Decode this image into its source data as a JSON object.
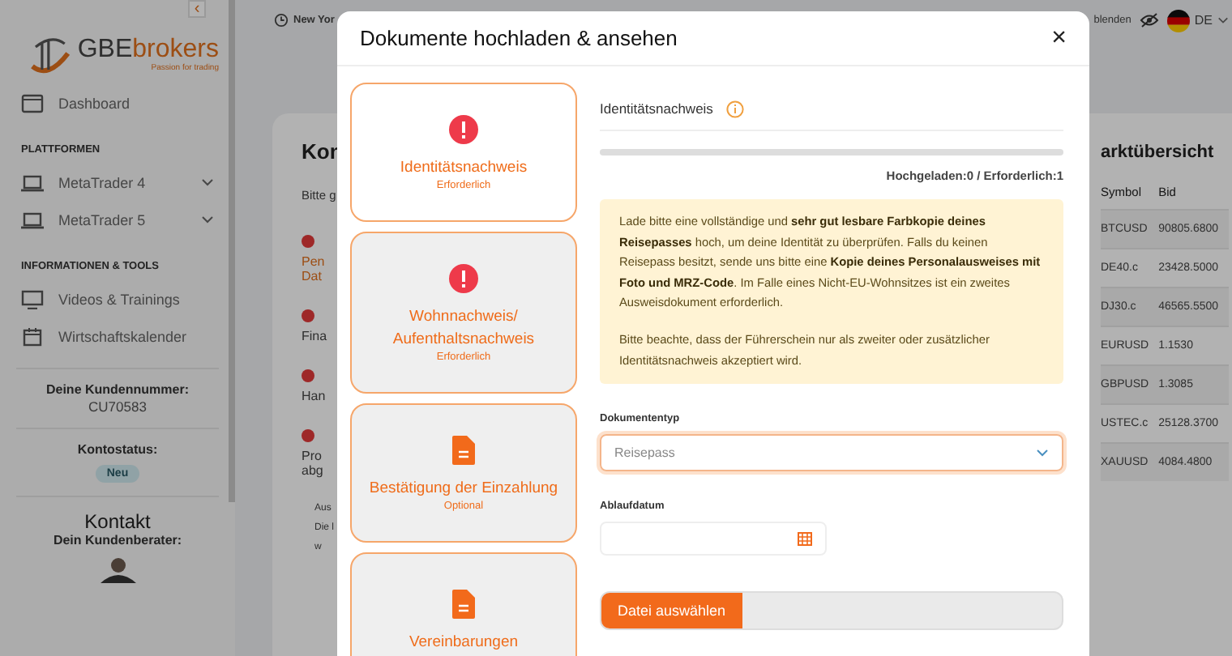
{
  "sidebar": {
    "logo": {
      "brand_a": "GBE",
      "brand_b": "brokers",
      "tagline": "Passion for trading"
    },
    "collapse_glyph": "‹",
    "items": [
      {
        "kind": "link",
        "label": "Dashboard"
      },
      {
        "kind": "section",
        "label": "PLATTFORMEN"
      },
      {
        "kind": "link",
        "label": "MetaTrader 4",
        "expandable": true
      },
      {
        "kind": "link",
        "label": "MetaTrader 5",
        "expandable": true
      },
      {
        "kind": "section",
        "label": "INFORMATIONEN & TOOLS"
      },
      {
        "kind": "link",
        "label": "Videos & Trainings"
      },
      {
        "kind": "link",
        "label": "Wirtschaftskalender"
      }
    ],
    "customer": {
      "label": "Deine Kundennummer:",
      "value": "CU70583"
    },
    "status": {
      "label": "Kontostatus:",
      "badge": "Neu"
    },
    "contact": {
      "title": "Kontakt",
      "subtitle": "Dein Kundenberater:"
    }
  },
  "topbar": {
    "clock": "New Yor",
    "toggle": "blenden",
    "language": "DE"
  },
  "account_card": {
    "title": "Kon",
    "intro": "Bitte g",
    "items": [
      {
        "lines": [
          "Pen",
          "Dat"
        ],
        "highlighted": true
      },
      {
        "lines": [
          "Fina"
        ],
        "highlighted": false
      },
      {
        "lines": [
          "Han"
        ],
        "highlighted": false
      },
      {
        "lines": [
          "Pro",
          "abg"
        ],
        "highlighted": false
      }
    ],
    "footer": [
      "Aus",
      "Die l",
      "w"
    ]
  },
  "market": {
    "title": "arktübersicht",
    "columns": [
      "Symbol",
      "Bid"
    ],
    "rows": [
      [
        "BTCUSD",
        "90805.6800"
      ],
      [
        "DE40.c",
        "23428.5000"
      ],
      [
        "DJ30.c",
        "46565.5500"
      ],
      [
        "EURUSD",
        "1.1530"
      ],
      [
        "GBPUSD",
        "1.3085"
      ],
      [
        "USTEC.c",
        "25128.3700"
      ],
      [
        "XAUUSD",
        "4084.4800"
      ]
    ]
  },
  "modal": {
    "title": "Dokumente hochladen & ansehen",
    "close": "×",
    "documents": [
      {
        "kind": "error",
        "title": "Identitätsnachweis",
        "status": "Erforderlich",
        "selected": true
      },
      {
        "kind": "error",
        "title": "Wohnnachweis/ Aufenthaltsnachweis",
        "status": "Erforderlich",
        "selected": false
      },
      {
        "kind": "document",
        "title": "Bestätigung der Einzahlung",
        "status": "Optional",
        "selected": false
      },
      {
        "kind": "document",
        "title": "Vereinbarungen",
        "selected": false
      }
    ],
    "section_title": "Identitätsnachweis",
    "progress": {
      "level": 0,
      "caption": "Hochgeladen:0 / Erforderlich:1"
    },
    "notice": [
      "Lade bitte eine vollständige und **sehr gut lesbare Farbkopie deines Reisepasses** hoch, um deine Identität zu überprüfen. Falls du keinen Reisepass besitzt, sende uns bitte eine **Kopie deines Personalausweises mit Foto und MRZ-Code**. Im Falle eines Nicht-EU-Wohnsitzes ist ein zweites Ausweisdokument erforderlich.",
      "Bitte beachte, dass der Führerschein nur als zweiter oder zusätzlicher Identitätsnachweis akzeptiert wird."
    ],
    "document_type": {
      "label": "Dokumententyp",
      "value": "Reisepass"
    },
    "expiry": {
      "label": "Ablaufdatum"
    },
    "file_button": "Datei auswählen"
  }
}
